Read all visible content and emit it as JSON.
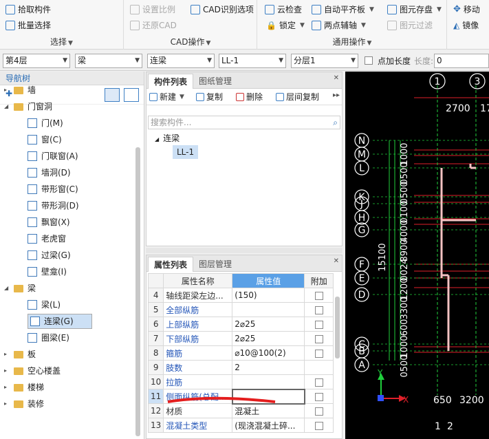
{
  "ribbon": {
    "select_group": {
      "pick": "拾取构件",
      "batch": "批量选择",
      "name": "选择"
    },
    "cad_group": {
      "scale": "设置比例",
      "cad_opts": "CAD识别选项",
      "restore": "还原CAD",
      "name": "CAD操作"
    },
    "general_group": {
      "cloud": "云检查",
      "align": "自动平齐板",
      "store": "图元存盘",
      "lock": "锁定",
      "twopoint": "两点辅轴",
      "filter": "图元过滤",
      "name": "通用操作"
    },
    "edit_group": {
      "move": "移动",
      "mirror": "镜像"
    }
  },
  "selbar": {
    "floor": "第4层",
    "type": "梁",
    "sub": "连梁",
    "item": "LL-1",
    "layer": "分层1",
    "point_len_label": "点加长度",
    "len_label": "长度:",
    "len_value": "0"
  },
  "nav": {
    "title": "导航树",
    "items": [
      {
        "label": "墙",
        "kind": "folder",
        "expanded": false
      },
      {
        "label": "门窗洞",
        "kind": "folder",
        "expanded": true
      },
      {
        "label": "门(M)",
        "kind": "leaf"
      },
      {
        "label": "窗(C)",
        "kind": "leaf"
      },
      {
        "label": "门联窗(A)",
        "kind": "leaf"
      },
      {
        "label": "墙洞(D)",
        "kind": "leaf"
      },
      {
        "label": "带形窗(C)",
        "kind": "leaf"
      },
      {
        "label": "带形洞(D)",
        "kind": "leaf"
      },
      {
        "label": "飘窗(X)",
        "kind": "leaf"
      },
      {
        "label": "老虎窗",
        "kind": "leaf"
      },
      {
        "label": "过梁(G)",
        "kind": "leaf"
      },
      {
        "label": "壁龛(I)",
        "kind": "leaf"
      },
      {
        "label": "梁",
        "kind": "folder",
        "expanded": true
      },
      {
        "label": "梁(L)",
        "kind": "leaf"
      },
      {
        "label": "连梁(G)",
        "kind": "leaf",
        "selected": true
      },
      {
        "label": "圈梁(E)",
        "kind": "leaf"
      },
      {
        "label": "板",
        "kind": "folder",
        "expanded": false
      },
      {
        "label": "空心楼盖",
        "kind": "folder",
        "expanded": false
      },
      {
        "label": "楼梯",
        "kind": "folder",
        "expanded": false
      },
      {
        "label": "装修",
        "kind": "folder",
        "expanded": false
      }
    ]
  },
  "comp": {
    "tab_list": "构件列表",
    "tab_drawing": "图纸管理",
    "new": "新建",
    "copy": "复制",
    "delete": "删除",
    "floor_copy": "层间复制",
    "search_placeholder": "搜索构件...",
    "tree_parent": "连梁",
    "tree_child": "LL-1"
  },
  "prop": {
    "tab_list": "属性列表",
    "tab_layer": "图层管理",
    "col_name": "属性名称",
    "col_value": "属性值",
    "col_add": "附加",
    "rows": [
      {
        "n": "4",
        "name": "轴线距梁左边...",
        "value": "(150)",
        "check": true,
        "link": false
      },
      {
        "n": "5",
        "name": "全部纵筋",
        "value": "",
        "check": true,
        "link": true
      },
      {
        "n": "6",
        "name": "上部纵筋",
        "value": "2⌀25",
        "check": true,
        "link": true
      },
      {
        "n": "7",
        "name": "下部纵筋",
        "value": "2⌀25",
        "check": true,
        "link": true
      },
      {
        "n": "8",
        "name": "箍筋",
        "value": "⌀10@100(2)",
        "check": true,
        "link": true
      },
      {
        "n": "9",
        "name": "肢数",
        "value": "2",
        "check": false,
        "link": true
      },
      {
        "n": "10",
        "name": "拉筋",
        "value": "",
        "check": true,
        "link": true
      },
      {
        "n": "11",
        "name": "侧面纵筋(总配...",
        "value": "",
        "check": true,
        "link": true
      },
      {
        "n": "12",
        "name": "材质",
        "value": "混凝土",
        "check": true,
        "link": false
      },
      {
        "n": "13",
        "name": "混凝土类型",
        "value": "(现浇混凝土碎...",
        "check": true,
        "link": true
      }
    ]
  },
  "cad": {
    "top_axes": [
      "1",
      "3"
    ],
    "top_dims": [
      "2700",
      "17"
    ],
    "left_axes": [
      "N",
      "M",
      "L",
      "K",
      "J",
      "H",
      "G",
      "F",
      "E",
      "D",
      "C",
      "B",
      "A"
    ],
    "vertical_dims": [
      "15100",
      "1000",
      "0500",
      "0500",
      "0100",
      "4000",
      "8900",
      "0024",
      "1200",
      "3300",
      "600",
      "1000",
      "0500"
    ],
    "bottom_dims": [
      "650",
      "3200"
    ],
    "bottom_axes": [
      "1",
      "2"
    ],
    "ucs_x": "X",
    "ucs_y": "Y"
  },
  "colors": {
    "accent": "#2a6db5",
    "cad_green": "#1fcf3c",
    "cad_red": "#e0202a",
    "annot_red": "#e41e1e"
  }
}
